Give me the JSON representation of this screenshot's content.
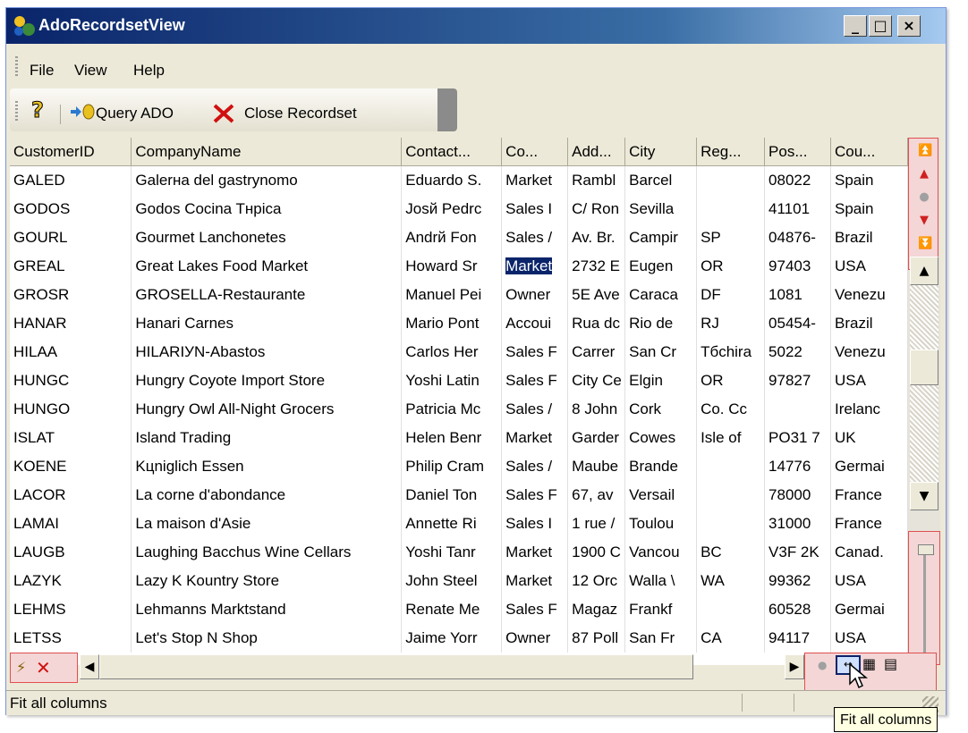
{
  "window": {
    "title": "AdoRecordsetView",
    "minimize_label": "_",
    "maximize_label": "□",
    "close_label": "×"
  },
  "menu": {
    "items": [
      {
        "label": "File"
      },
      {
        "label": "View"
      },
      {
        "label": "Help"
      }
    ]
  },
  "toolbar": {
    "help_icon": "question-mark-icon",
    "query_label": "Query ADO",
    "close_recordset_label": "Close Recordset"
  },
  "grid": {
    "columns": [
      "CustomerID",
      "CompanyName",
      "Contact...",
      "Co...",
      "Add...",
      "City",
      "Reg...",
      "Pos...",
      "Cou..."
    ],
    "rows": [
      [
        "GALED",
        "Galerна del gastrynomo",
        "Eduardo S.",
        "Market",
        "Rambl",
        "Barcel",
        "",
        "08022",
        "Spain"
      ],
      [
        "GODOS",
        "Godos Cocina Tнpica",
        "Josй Pedrc",
        "Sales I",
        "C/ Ron",
        "Sevilla",
        "",
        "41101",
        "Spain"
      ],
      [
        "GOURL",
        "Gourmet Lanchonetes",
        "Andrй Fon",
        "Sales /",
        "Av. Br.",
        "Campir",
        "SP",
        "04876-",
        "Brazil"
      ],
      [
        "GREAL",
        "Great Lakes Food Market",
        "Howard Sr",
        "Market",
        "2732 E",
        "Eugen",
        "OR",
        "97403",
        "USA"
      ],
      [
        "GROSR",
        "GROSELLA-Restaurante",
        "Manuel Pei",
        "Owner",
        "5E Ave",
        "Caraca",
        "DF",
        "1081",
        "Venezu"
      ],
      [
        "HANAR",
        "Hanari Carnes",
        "Mario Pont",
        "Accoui",
        "Rua dc",
        "Rio de",
        "RJ",
        "05454-",
        "Brazil"
      ],
      [
        "HILAA",
        "HILARIУN-Abastos",
        "Carlos Her",
        "Sales F",
        "Carrer",
        "San Cr",
        "Tбchira",
        "5022",
        "Venezu"
      ],
      [
        "HUNGC",
        "Hungry Coyote Import Store",
        "Yoshi Latin",
        "Sales F",
        "City Ce",
        "Elgin",
        "OR",
        "97827",
        "USA"
      ],
      [
        "HUNGO",
        "Hungry Owl All-Night Grocers",
        "Patricia Mc",
        "Sales /",
        "8 John",
        "Cork",
        "Co. Cc",
        "",
        "Irelanc"
      ],
      [
        "ISLAT",
        "Island Trading",
        "Helen Benr",
        "Market",
        "Garder",
        "Cowes",
        "Isle of",
        "PO31 7",
        "UK"
      ],
      [
        "KOENE",
        "Kцniglich Essen",
        "Philip Cram",
        "Sales /",
        "Maube",
        "Brande",
        "",
        "14776",
        "Germai"
      ],
      [
        "LACOR",
        "La corne d'abondance",
        "Daniel Ton",
        "Sales F",
        "67, av",
        "Versail",
        "",
        "78000",
        "France"
      ],
      [
        "LAMAI",
        "La maison d'Asie",
        "Annette Ri",
        "Sales I",
        "1 rue /",
        "Toulou",
        "",
        "31000",
        "France"
      ],
      [
        "LAUGB",
        "Laughing Bacchus Wine Cellars",
        "Yoshi Tanr",
        "Market",
        "1900 C",
        "Vancou",
        "BC",
        "V3F 2K",
        "Canad."
      ],
      [
        "LAZYK",
        "Lazy K Kountry Store",
        "John Steel",
        "Market",
        "12 Orc",
        "Walla \\",
        "WA",
        "99362",
        "USA"
      ],
      [
        "LEHMS",
        "Lehmanns Marktstand",
        "Renate Me",
        "Sales F",
        "Magaz",
        "Frankf",
        "",
        "60528",
        "Germai"
      ],
      [
        "LETSS",
        "Let's Stop N Shop",
        "Jaime Yorr",
        "Owner",
        "87 Poll",
        "San Fr",
        "CA",
        "94117",
        "USA"
      ]
    ],
    "selected_row": 3,
    "selected_col": 3
  },
  "status": {
    "text": "Fit all columns"
  },
  "tooltip": {
    "text": "Fit all columns"
  },
  "colors": {
    "selection": "#0a246a",
    "highlight_border": "#e05050"
  }
}
